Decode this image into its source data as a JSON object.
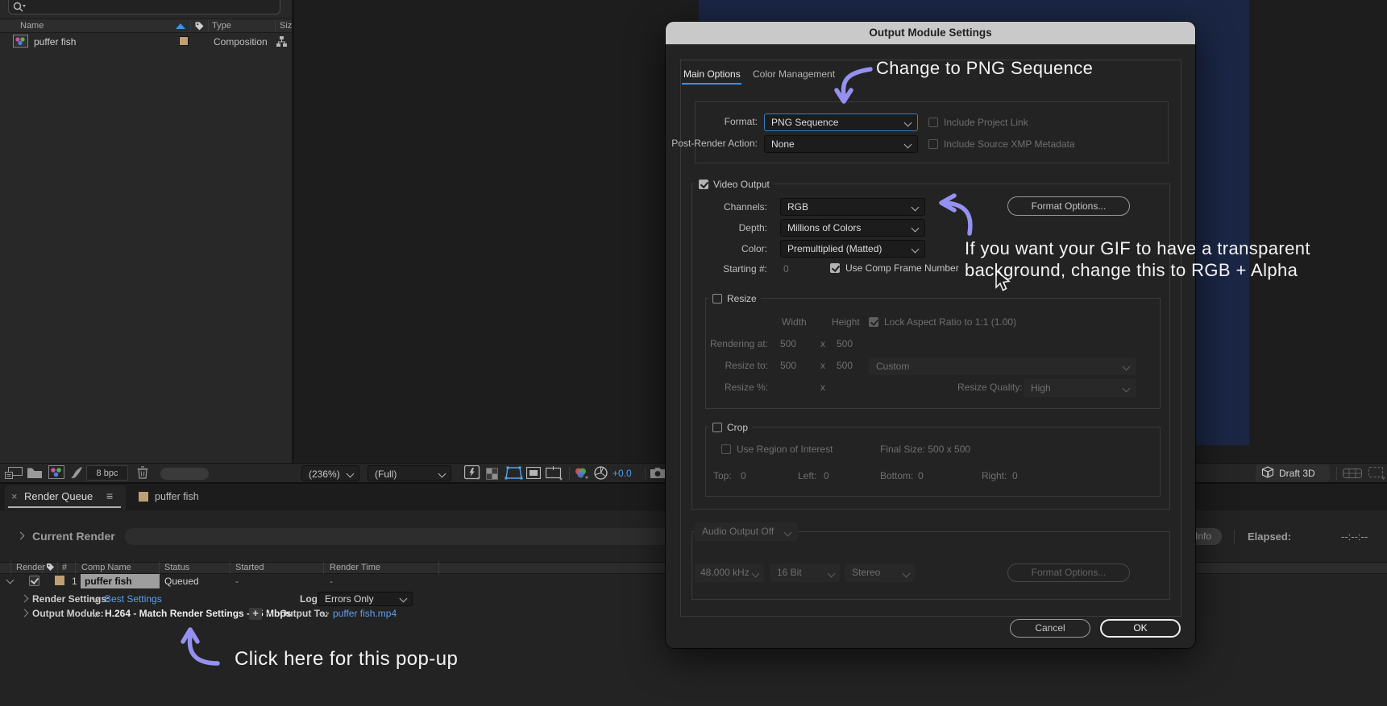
{
  "colors": {
    "accent_blue": "#3f8fe0",
    "link_blue": "#5d9ff0",
    "annotation_purple": "#9591f0",
    "comp_swatch_tan": "#bfa075",
    "comp_viewer_navy": "#1a2644",
    "dialog_titlebar": "#c9c9c9"
  },
  "icons": {
    "close": "×",
    "panel_menu": "≡",
    "plus": "+",
    "minus": "−"
  },
  "project_panel": {
    "columns": {
      "name": "Name",
      "type": "Type",
      "size": "Siz"
    },
    "item": {
      "name": "puffer fish",
      "type": "Composition"
    },
    "footer": {
      "bit_depth": "8 bpc"
    }
  },
  "viewer_toolbar": {
    "zoom": "(236%)",
    "resolution": "(Full)",
    "exposure": "+0.0",
    "draft_3d": "Draft 3D"
  },
  "render_queue": {
    "tab": "Render Queue",
    "comp_tab": "puffer fish",
    "current_render": "Current Render",
    "info": "Info",
    "elapsed_label": "Elapsed:",
    "elapsed_value": "--:--:--",
    "columns": {
      "render": "Render",
      "num": "#",
      "comp_name": "Comp Name",
      "status": "Status",
      "started": "Started",
      "render_time": "Render Time"
    },
    "row": {
      "num": "1",
      "comp_name": "puffer fish",
      "status": "Queued",
      "started": "-",
      "render_time": "-"
    },
    "render_settings_label": "Render Settings:",
    "render_settings_value": "Best Settings",
    "log_label": "Log:",
    "log_value": "Errors Only",
    "output_module_label": "Output Module:",
    "output_module_value": "H.264 - Match Render Settings - 15 Mbps",
    "output_to_label": "Output To:",
    "output_to_value": "puffer fish.mp4"
  },
  "dialog": {
    "title": "Output Module Settings",
    "tabs": {
      "main": "Main Options",
      "color": "Color Management"
    },
    "format": {
      "label": "Format:",
      "value": "PNG Sequence"
    },
    "post_render": {
      "label": "Post-Render Action:",
      "value": "None"
    },
    "include_project_link": "Include Project Link",
    "include_xmp": "Include Source XMP Metadata",
    "video_output_label": "Video Output",
    "channels": {
      "label": "Channels:",
      "value": "RGB"
    },
    "depth": {
      "label": "Depth:",
      "value": "Millions of Colors"
    },
    "color": {
      "label": "Color:",
      "value": "Premultiplied (Matted)"
    },
    "starting": {
      "label": "Starting #:",
      "value": "0"
    },
    "use_comp_frame_label": "Use Comp Frame Number",
    "format_options_label": "Format Options...",
    "resize": {
      "label": "Resize",
      "width": "Width",
      "height": "Height",
      "lock_aspect": "Lock Aspect Ratio to 1:1 (1.00)",
      "rendering_at_label": "Rendering at:",
      "rendering_w": "500",
      "rendering_h": "500",
      "resize_to_label": "Resize to:",
      "resize_w": "500",
      "resize_h": "500",
      "preset": "Custom",
      "resize_pct_label": "Resize %:",
      "x_sep": "x",
      "quality_label": "Resize Quality:",
      "quality_value": "High"
    },
    "crop": {
      "label": "Crop",
      "use_roi": "Use Region of Interest",
      "final_size": "Final Size: 500 x 500",
      "top_label": "Top:",
      "top": "0",
      "left_label": "Left:",
      "left": "0",
      "bottom_label": "Bottom:",
      "bottom": "0",
      "right_label": "Right:",
      "right": "0"
    },
    "audio": {
      "label": "Audio Output Off",
      "rate": "48.000 kHz",
      "depth": "16 Bit",
      "channels": "Stereo",
      "format_options": "Format Options..."
    },
    "cancel_label": "Cancel",
    "ok_label": "OK"
  },
  "annotations": {
    "change_format": "Change to PNG Sequence",
    "alpha_line1": "If you want your GIF to have a transparent",
    "alpha_line2": "background, change this to RGB + Alpha",
    "popup": "Click here for this pop-up"
  }
}
